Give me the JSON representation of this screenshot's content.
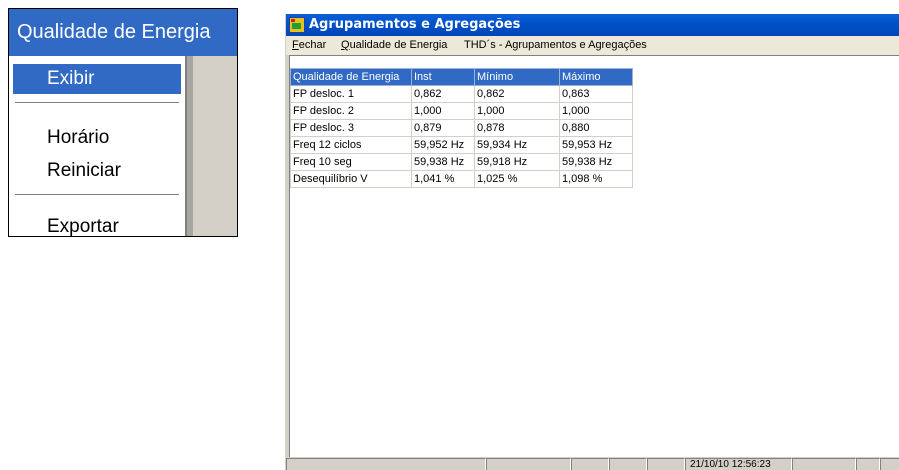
{
  "zoom_menu": {
    "title": "Qualidade de Energia",
    "items": [
      {
        "label": "Exibir",
        "selected": true
      },
      {
        "separator": true
      },
      {
        "label": "Horário"
      },
      {
        "label": "Reiniciar"
      },
      {
        "separator": true
      },
      {
        "label": "Exportar"
      }
    ]
  },
  "window": {
    "title": "Agrupamentos e Agregações",
    "menubar": [
      {
        "first": "F",
        "rest": "echar"
      },
      {
        "first": "Q",
        "rest": "ualidade de Energia"
      },
      {
        "first": "",
        "rest": "THD´s - Agrupamentos e Agregações"
      }
    ]
  },
  "table": {
    "headers": [
      "Qualidade de Energia",
      "Inst",
      "Mínimo",
      "Máximo"
    ],
    "rows": [
      [
        "FP desloc. 1",
        "0,862",
        "0,862",
        "0,863"
      ],
      [
        "FP desloc. 2",
        "1,000",
        "1,000",
        "1,000"
      ],
      [
        "FP desloc. 3",
        "0,879",
        "0,878",
        "0,880"
      ],
      [
        "Freq 12 ciclos",
        "59,952 Hz",
        "59,934 Hz",
        "59,953 Hz"
      ],
      [
        "Freq 10 seg",
        "59,938 Hz",
        "59,918 Hz",
        "59,938 Hz"
      ],
      [
        "Desequilíbrio V",
        "1,041 %",
        "1,025 %",
        "1,098 %"
      ]
    ]
  },
  "status_bar": {
    "timestamp": "21/10/10 12:56:23"
  },
  "colors": {
    "selection": "#316ac5",
    "titlebar": "#0054e3",
    "menubar": "#ece9d8",
    "frame": "#d4d0c8"
  }
}
